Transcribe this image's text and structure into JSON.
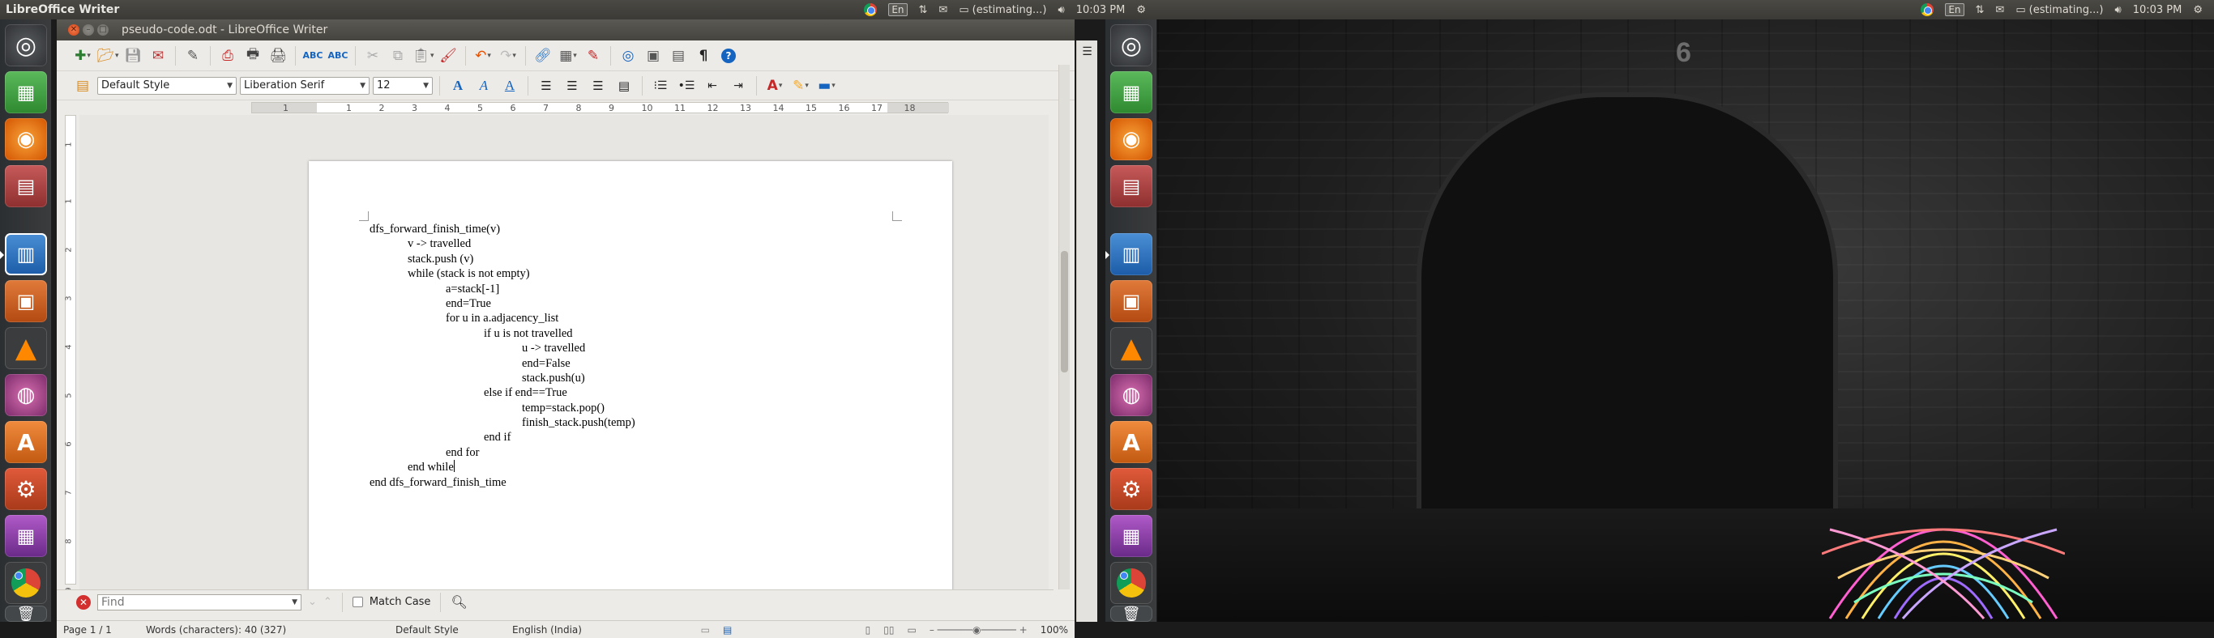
{
  "panel": {
    "app_name": "LibreOffice Writer",
    "keyboard_layout": "En",
    "battery_status": "(estimating...)",
    "clock": "10:03 PM"
  },
  "window": {
    "title": "pseudo-code.odt - LibreOffice Writer"
  },
  "format_bar": {
    "paragraph_style": "Default Style",
    "font_name": "Liberation Serif",
    "font_size": "12"
  },
  "ruler": {
    "ticks": [
      "1",
      "1",
      "2",
      "3",
      "4",
      "5",
      "6",
      "7",
      "8",
      "9",
      "10",
      "11",
      "12",
      "13",
      "14",
      "15",
      "16",
      "17",
      "18"
    ],
    "vticks": [
      "1",
      "1",
      "2",
      "3",
      "4",
      "5",
      "6",
      "7",
      "8",
      "9"
    ]
  },
  "document": {
    "lines": [
      {
        "indent": 0,
        "text": "dfs_forward_finish_time(v)"
      },
      {
        "indent": 1,
        "text": "v -> travelled"
      },
      {
        "indent": 1,
        "text": "stack.push (v)"
      },
      {
        "indent": 1,
        "text": "while (stack is not empty)"
      },
      {
        "indent": 2,
        "text": "a=stack[-1]"
      },
      {
        "indent": 2,
        "text": "end=True"
      },
      {
        "indent": 2,
        "text": "for u in a.adjacency_list"
      },
      {
        "indent": 3,
        "text": "if u is not travelled"
      },
      {
        "indent": 4,
        "text": "u -> travelled"
      },
      {
        "indent": 4,
        "text": "end=False"
      },
      {
        "indent": 4,
        "text": "stack.push(u)"
      },
      {
        "indent": 3,
        "text": "else if end==True"
      },
      {
        "indent": 4,
        "text": "temp=stack.pop()"
      },
      {
        "indent": 4,
        "text": "finish_stack.push(temp)"
      },
      {
        "indent": 3,
        "text": "end if"
      },
      {
        "indent": 2,
        "text": "end for"
      },
      {
        "indent": 1,
        "text": "end while"
      },
      {
        "indent": 0,
        "text": "end dfs_forward_finish_time"
      }
    ]
  },
  "find_bar": {
    "placeholder": "Find",
    "match_case_label": "Match Case"
  },
  "status_bar": {
    "page": "Page 1 / 1",
    "word_count": "Words (characters): 40 (327)",
    "page_style": "Default Style",
    "language": "English (India)",
    "zoom": "100%"
  },
  "wallpaper": {
    "door_number": "6"
  },
  "colors": {
    "panel_bg": "#3c3b37",
    "window_bg": "#edebe8",
    "close_button": "#e2531d",
    "find_close": "#d32f2f"
  },
  "icons": {
    "launcher": [
      "ubuntu-dash-icon",
      "libreoffice-calc-icon",
      "firefox-icon",
      "file-manager-icon",
      "libreoffice-writer-icon",
      "libreoffice-impress-icon",
      "vlc-icon",
      "blender-icon",
      "software-center-icon",
      "system-settings-icon",
      "workspace-switcher-icon",
      "chrome-icon",
      "trash-icon"
    ]
  }
}
